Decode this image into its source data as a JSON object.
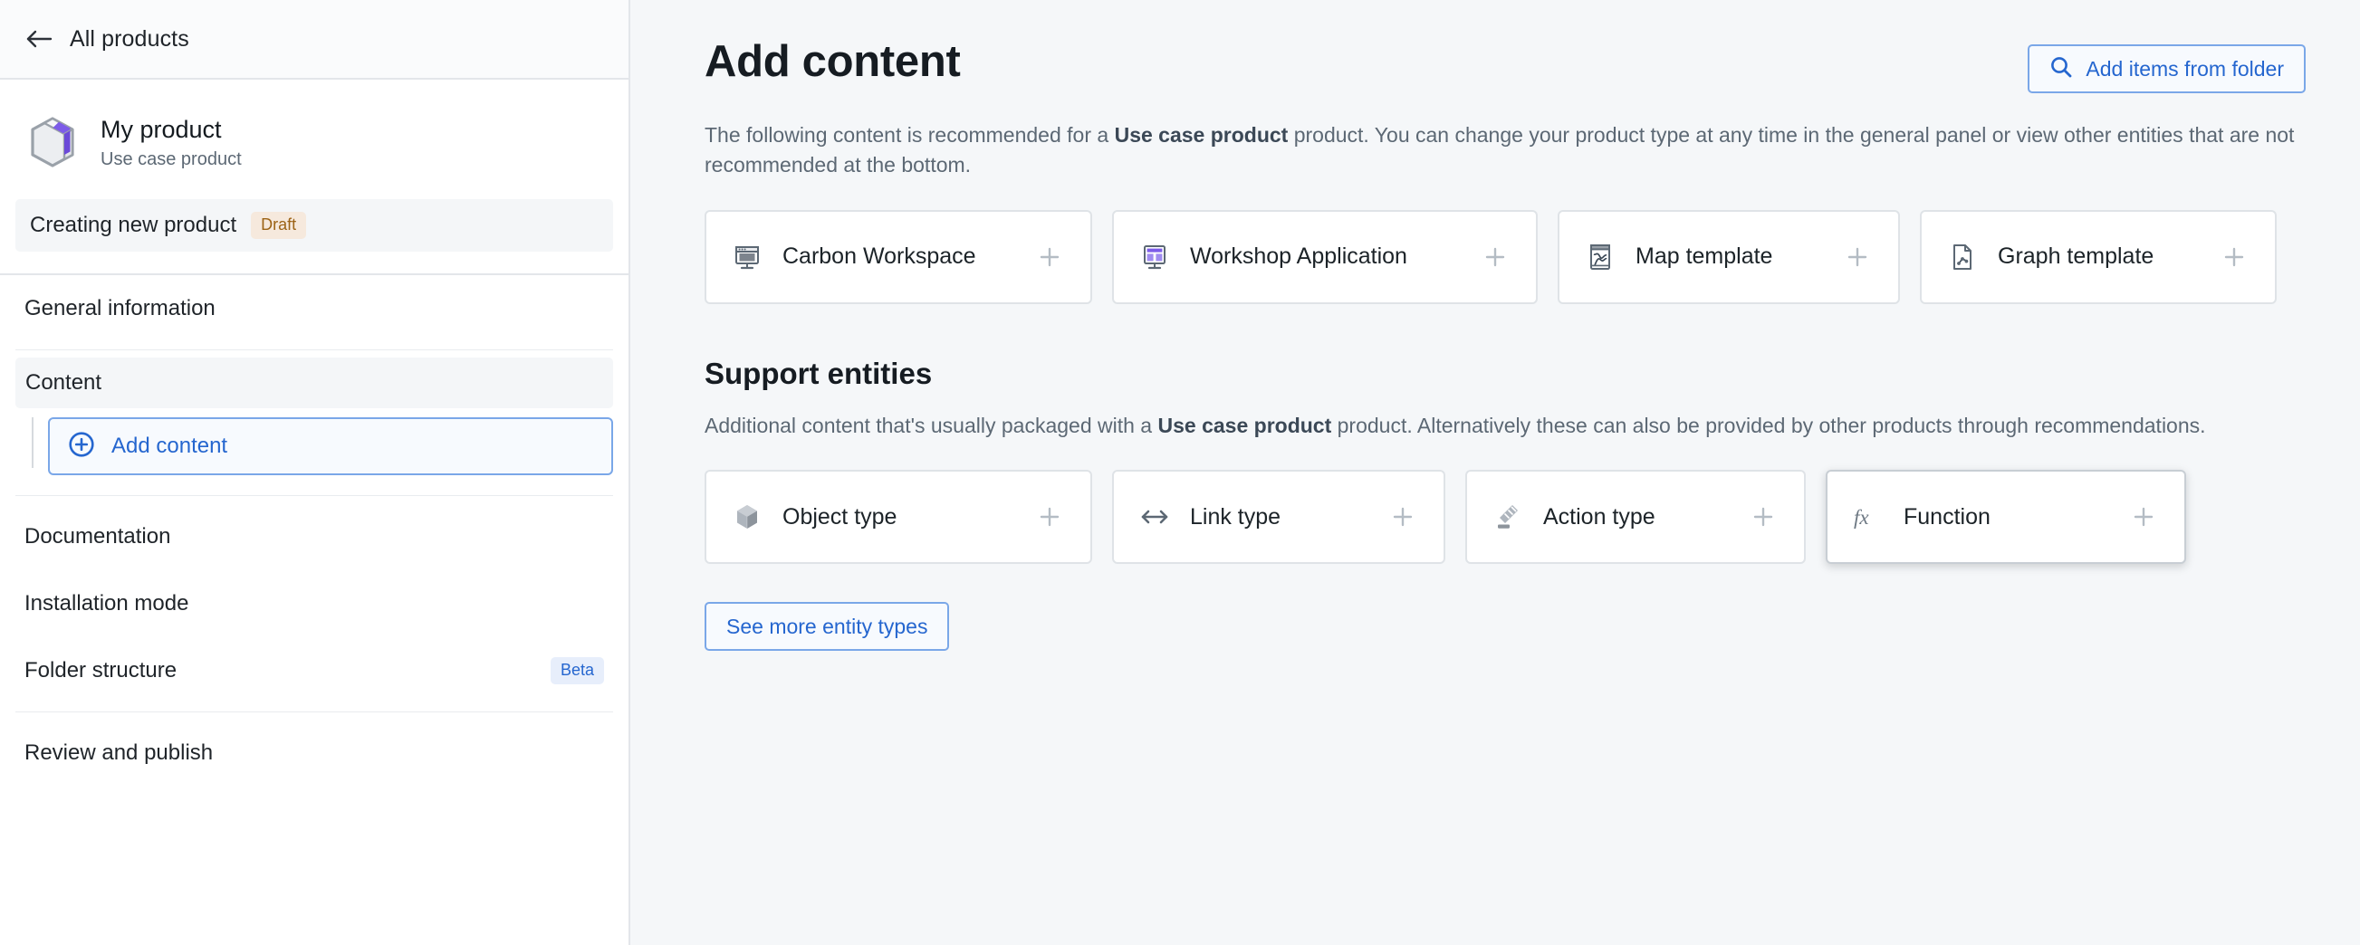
{
  "sidebar": {
    "back": {
      "label": "All products",
      "icon": "arrow-left-icon"
    },
    "product": {
      "name": "My product",
      "subtitle": "Use case product",
      "icon": "product-box-icon"
    },
    "status_row": {
      "label": "Creating new product",
      "badge": "Draft"
    },
    "nav": [
      {
        "label": "General information",
        "badge": "",
        "active": false
      },
      {
        "label": "Content",
        "badge": "",
        "active": true
      },
      {
        "label": "Documentation",
        "badge": "",
        "active": false
      },
      {
        "label": "Installation mode",
        "badge": "",
        "active": false
      },
      {
        "label": "Folder structure",
        "badge": "Beta",
        "active": false
      },
      {
        "label": "Review and publish",
        "badge": "",
        "active": false
      }
    ],
    "add_content": {
      "label": "Add content",
      "icon": "plus-circle-icon"
    }
  },
  "main": {
    "title": "Add content",
    "folder_button": {
      "label": "Add items from folder",
      "icon": "search-icon"
    },
    "description": {
      "part1": "The following content is recommended for a ",
      "emphasis": "Use case product",
      "part2": " product. You can change your product type at any time in the general panel or view other entities that are not recommended at the bottom."
    },
    "recommended_cards": [
      {
        "label": "Carbon Workspace",
        "icon": "monitor-icon",
        "action": "plus-icon"
      },
      {
        "label": "Workshop Application",
        "icon": "workshop-layout-icon",
        "action": "plus-icon"
      },
      {
        "label": "Map template",
        "icon": "map-icon",
        "action": "plus-icon"
      },
      {
        "label": "Graph template",
        "icon": "graph-document-icon",
        "action": "plus-icon"
      }
    ],
    "support": {
      "title": "Support entities",
      "description": {
        "part1": "Additional content that's usually packaged with a ",
        "emphasis": "Use case product",
        "part2": " product. Alternatively these can also be provided by other products through recommendations."
      },
      "cards": [
        {
          "label": "Object type",
          "icon": "cube-icon",
          "action": "plus-icon",
          "hovered": false
        },
        {
          "label": "Link type",
          "icon": "arrows-horizontal-icon",
          "action": "plus-icon",
          "hovered": false
        },
        {
          "label": "Action type",
          "icon": "gavel-icon",
          "action": "plus-icon",
          "hovered": false
        },
        {
          "label": "Function",
          "icon": "fx-icon",
          "action": "plus-icon",
          "hovered": true
        }
      ]
    },
    "see_more": {
      "label": "See more entity types"
    }
  },
  "colors": {
    "accent_blue": "#2566cf",
    "draft_badge_bg": "#f6e9dd",
    "draft_badge_fg": "#9c6316",
    "beta_badge_bg": "#e7eefb",
    "beta_badge_fg": "#2566cf",
    "canvas": "#f5f7f9",
    "purple": "#7d5ce8"
  }
}
